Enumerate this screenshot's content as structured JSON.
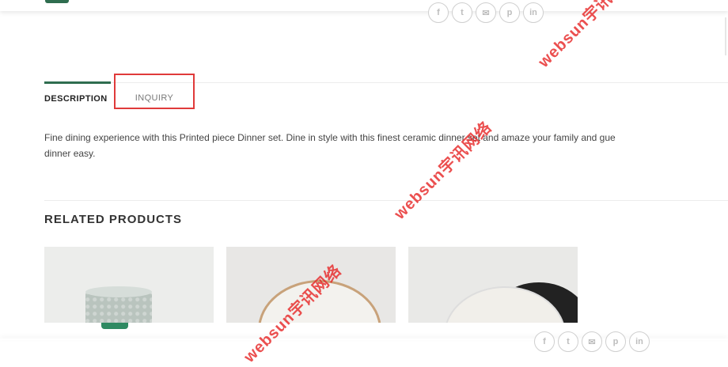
{
  "share_icons": [
    "f",
    "t",
    "✉",
    "p",
    "in"
  ],
  "tabs": {
    "description": "DESCRIPTION",
    "inquiry": "INQUIRY"
  },
  "description_text": "Fine dining experience with this Printed piece Dinner set. Dine in style with this finest ceramic dinner set and amaze your family and gue",
  "description_text_line2": "dinner easy.",
  "related_title": "RELATED PRODUCTS",
  "watermark": "websun宇讯网络",
  "colors": {
    "accent_green": "#2f6d4f",
    "highlight_red": "#e03a3a",
    "watermark_red": "#e62828"
  }
}
